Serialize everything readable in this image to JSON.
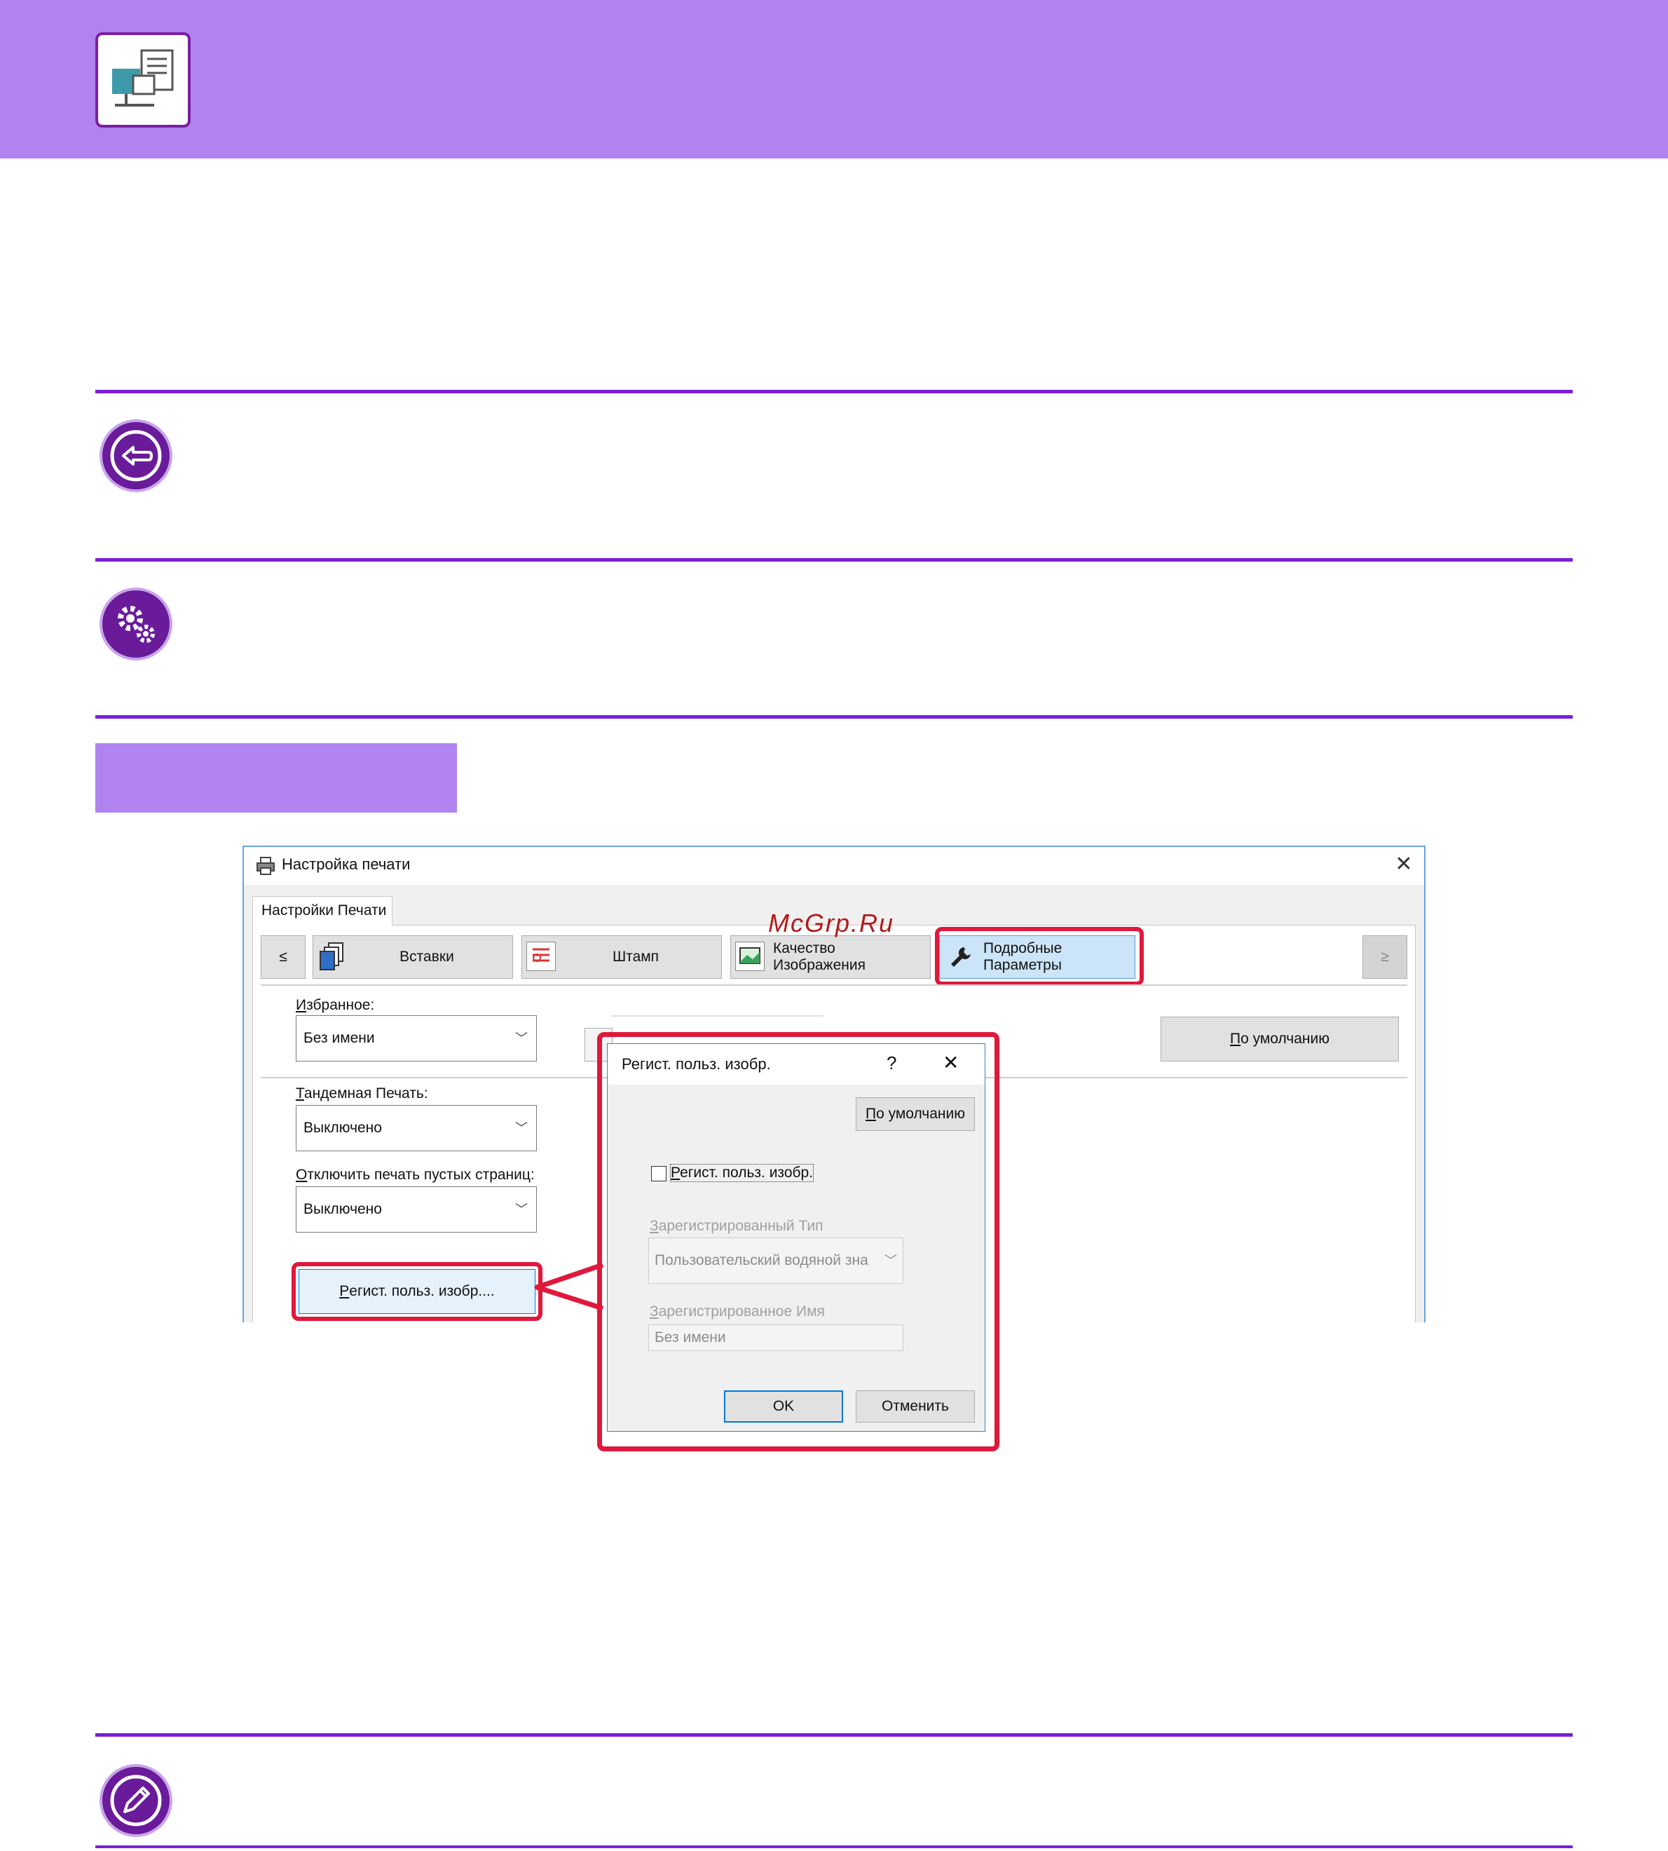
{
  "watermark": "McGrp.Ru",
  "window": {
    "title": "Настройка печати",
    "close_glyph": "✕",
    "tab_main": "Настройки Печати",
    "toolbar": {
      "prev": "≤",
      "inserts": "Вставки",
      "stamp": "Штамп",
      "image_quality": "Качество Изображения",
      "advanced": "Подробные Параметры",
      "next": "≥"
    },
    "favorites": {
      "label_u": "И",
      "label_rest": "збранное:",
      "value": "Без имени"
    },
    "defaults_button": {
      "u": "П",
      "rest": "о умолчанию"
    },
    "tandem": {
      "label_u": "Т",
      "label_rest": "андемная Печать:",
      "value": "Выключено"
    },
    "skip_blank": {
      "label_u": "О",
      "label_rest": "тключить печать пустых страниц:",
      "value": "Выключено"
    },
    "custom_image_button": {
      "u": "Р",
      "rest": "егист. польз. изобр...."
    }
  },
  "dialog": {
    "title": "Регист. польз. изобр.",
    "help_glyph": "?",
    "close_glyph": "✕",
    "defaults_button": {
      "u": "П",
      "rest": "о умолчанию"
    },
    "checkbox": {
      "u": "Р",
      "rest": "егист. польз. изобр.",
      "checked": false
    },
    "registered_type": {
      "label_u": "З",
      "label_rest": "арегистрированный Тип",
      "value": "Пользовательский водяной зна"
    },
    "registered_name": {
      "label_u": "З",
      "label_rest": "арегистрированное Имя",
      "value": "Без имени"
    },
    "ok": "OK",
    "cancel": "Отменить"
  },
  "colors": {
    "accent_purple": "#b183f1",
    "rule_purple": "#7a1fd6",
    "highlight_red": "#e0183c"
  },
  "icons": [
    "printer-doc-icon",
    "back-arrow-icon",
    "gears-icon",
    "pencil-icon",
    "printer-icon",
    "wrench-icon"
  ]
}
